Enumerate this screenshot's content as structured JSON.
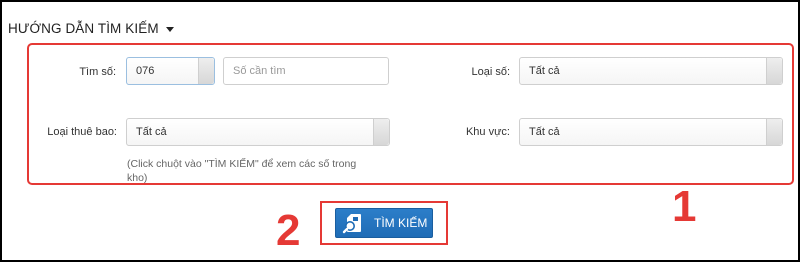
{
  "header": {
    "title": "HƯỚNG DẪN TÌM KIẾM"
  },
  "search_form": {
    "tim_so": {
      "label": "Tìm số:",
      "prefix_value": "076",
      "number_placeholder": "Số cần tìm"
    },
    "loai_so": {
      "label": "Loại số:",
      "selected": "Tất cả"
    },
    "loai_thue_bao": {
      "label": "Loại thuê bao:",
      "selected": "Tất cả"
    },
    "khu_vuc": {
      "label": "Khu vực:",
      "selected": "Tất cả"
    },
    "hint": "(Click chuột vào \"TÌM KIẾM\" để xem các số trong kho)"
  },
  "search_button": {
    "label": "TÌM KIẾM",
    "icon": "sim-search-icon"
  },
  "annotations": {
    "panel_number": "1",
    "button_number": "2",
    "color": "#e53935"
  },
  "colors": {
    "button_blue": "#1f6cb6",
    "highlight_red": "#e53935"
  }
}
